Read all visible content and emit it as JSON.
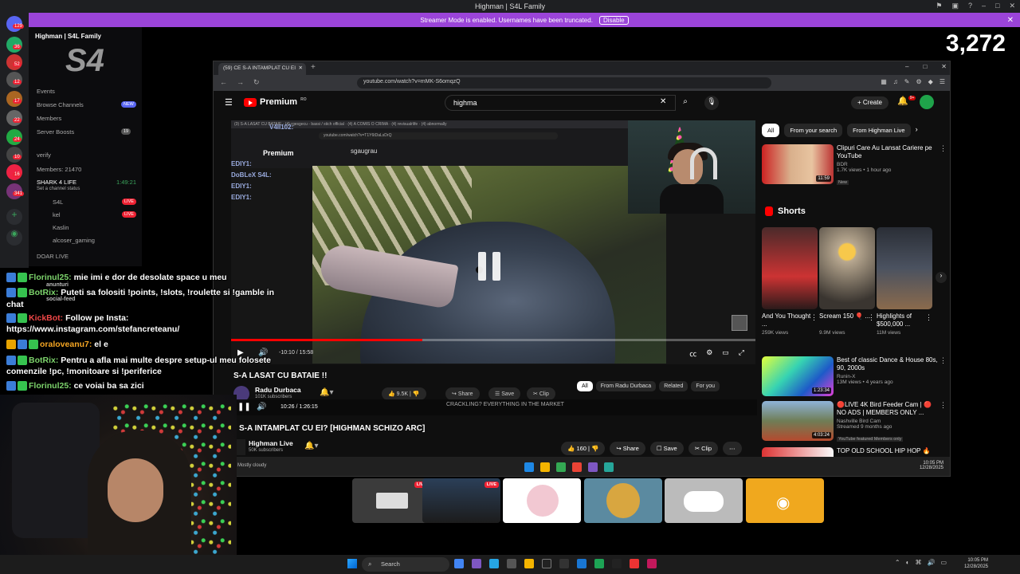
{
  "window": {
    "title": "Highman | S4L Family",
    "streamer_banner": "Streamer Mode is enabled. Usernames have been truncated.",
    "disable_label": "Disable"
  },
  "viewer_count": "3,272",
  "discord": {
    "server_name": "Highman | S4L Family",
    "rail_badges": [
      "129",
      "36",
      "52",
      "12",
      "17",
      "22",
      "24",
      "10",
      "16",
      "341"
    ],
    "menu": [
      {
        "label": "Events",
        "badge": ""
      },
      {
        "label": "Browse Channels",
        "badge": "NEW"
      },
      {
        "label": "Members",
        "badge": ""
      },
      {
        "label": "Server Boosts",
        "badge": "19"
      }
    ],
    "channels": [
      "verify",
      "Members: 21470",
      "SHARK 4 LIFE",
      "Set a channel status",
      "S4L",
      "kel",
      "Kaslin",
      "alcoser_gaming",
      "DOAR LIVE"
    ],
    "voice_time": "1:49:21",
    "live_label": "LIVE"
  },
  "chat": [
    {
      "name": "Florinul25:",
      "text": " mie imi e dor de desolate space u meu",
      "color": "green"
    },
    {
      "name": "BotRix:",
      "text": " Puteti sa folositi !points, !slots, !roulette si !gamble in",
      "color": "green"
    },
    {
      "name": "",
      "text": "chat",
      "color": "green"
    },
    {
      "name": "KickBot:",
      "text": " Follow pe Insta:",
      "color": "red"
    },
    {
      "name": "",
      "text": "https://www.instagram.com/stefancreteanu/",
      "color": "red"
    },
    {
      "name": "oraloveanu7:",
      "text": " el e",
      "color": "orange"
    },
    {
      "name": "BotRix:",
      "text": " Pentru a afla mai multe despre setup-ul meu folosete",
      "color": "green"
    },
    {
      "name": "",
      "text": "comenzile !pc, !monitoare si !periferice",
      "color": "green"
    },
    {
      "name": "Florinul25:",
      "text": " ce voiai ba sa zici",
      "color": "green"
    }
  ],
  "chat_side_labels": [
    "anunturi",
    "social-feed"
  ],
  "browser": {
    "tab_title": "(59) CE S-A INTAMPLAT CU EI",
    "url": "youtube.com/watch?v=mMK-S6omqzQ"
  },
  "youtube": {
    "brand": "Premium",
    "region": "RO",
    "search_value": "highma",
    "create_label": "Create",
    "notif_count": "9+",
    "inner": {
      "search_value": "sgaugrau",
      "url": "youtube.com/watch?v=T1Y6tDaLsDrQ",
      "tabs": "(3) S-A LASAT CU BATAIE  ·  (4) rgesgecu - bassi / stich official  ·  (4) A COMIS O CRIMA  ·  (4) revisualrlife  ·  (4) abnormally",
      "strip_names": [
        "V4II102:",
        "EDIY1:",
        "DoBLeX S4L:",
        "EDIY1:",
        "EDIY1:"
      ]
    },
    "player": {
      "time": "-10:10 / 15:58",
      "progress": 0.365
    },
    "inner_video": {
      "title": "S-A LASAT CU BATAIE !!",
      "channel": "Radu Durbaca",
      "subs": "101K subscribers",
      "likes": "9.5K",
      "share": "Share",
      "save": "Save",
      "clip": "Clip",
      "chips": [
        "All",
        "From Radu Durbaca",
        "Related",
        "For you"
      ]
    },
    "overlay": {
      "time": "10:26 / 1:26:15",
      "ticker": "CRACKLING?     EVERYTHING IN THE MARKET"
    },
    "video": {
      "title": "S-A INTAMPLAT CU EI? [HIGHMAN SCHIZO ARC]",
      "channel": "Highman Live",
      "subs": "50K subscribers",
      "likes": "160",
      "share": "Share",
      "save": "Save",
      "clip": "Clip"
    },
    "inner_taskbar": {
      "weather": "Mostly cloudy",
      "time": "10:05 PM",
      "date": "12/28/2025"
    },
    "sidebar": {
      "chips": [
        "All",
        "From your search",
        "From Highman Live"
      ],
      "top_video": {
        "title": "Clipuri Care Au Lansat Cariere pe YouTube",
        "channel": "BDR",
        "meta": "1.7K views • 1 hour ago",
        "badge": "New",
        "duration": "11:59"
      },
      "shorts_label": "Shorts",
      "shorts": [
        {
          "title": "And You Thought ...",
          "views": "259K views"
        },
        {
          "title": "Scream 150 🎈 ...",
          "views": "9.9M views"
        },
        {
          "title": "Highlights of $500,000 ...",
          "views": "11M views"
        }
      ],
      "videos": [
        {
          "title": "Best of classic Dance & House 80s, 90, 2000s",
          "channel": "Runin-X",
          "meta": "13M views • 4 years ago",
          "badge": "",
          "duration": "1:23:34"
        },
        {
          "title": "🔴LIVE 4K Bird Feeder Cam | 🔴 NO ADS | MEMBERS ONLY ...",
          "channel": "Nashville Bird Cam",
          "meta": "Streamed 9 months ago",
          "badge": "YouTube featured  Members only",
          "duration": "4:03:24"
        },
        {
          "title": "TOP OLD SCHOOL HIP HOP 🔥",
          "channel": "",
          "meta": "",
          "badge": "",
          "duration": ""
        }
      ]
    }
  },
  "switcher": {
    "live_label": "LIVE"
  },
  "taskbar": {
    "search": "Search",
    "time": "10:05 PM",
    "date": "12/28/2025"
  },
  "colors": {
    "banner": "#9b44d9",
    "yt_red": "#ff0000",
    "live_red": "#e22233",
    "discord_blurple": "#5865f2",
    "chat_green": "#7cd36b"
  }
}
